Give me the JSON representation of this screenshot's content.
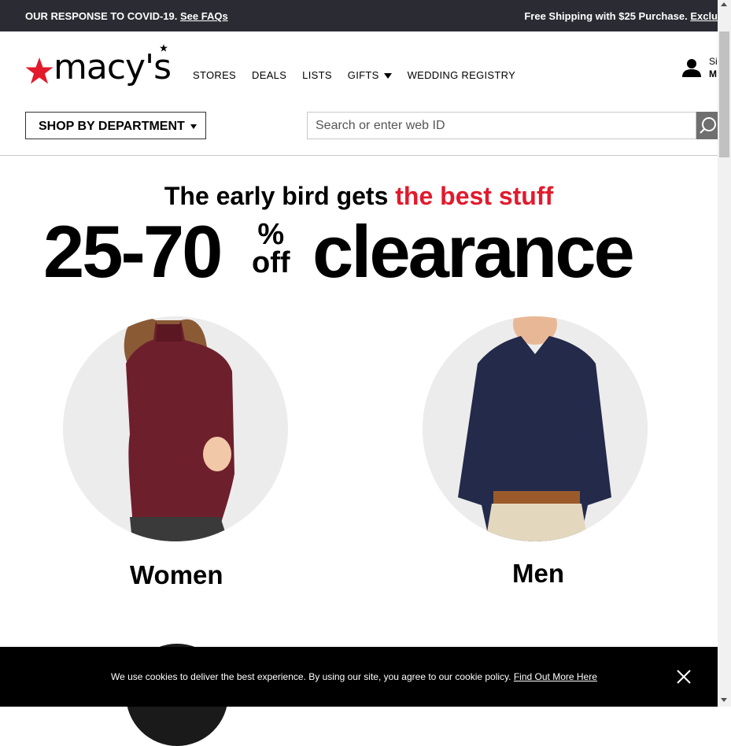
{
  "topbar": {
    "left_text": "OUR RESPONSE TO COVID-19.",
    "left_link": "See FAQs",
    "right_text": "Free Shipping with $25 Purchase.",
    "right_link": "Exclu"
  },
  "header": {
    "logo_text": "macy's",
    "nav": [
      {
        "label": "STORES"
      },
      {
        "label": "DEALS"
      },
      {
        "label": "LISTS"
      },
      {
        "label": "GIFTS"
      },
      {
        "label": "WEDDING REGISTRY"
      }
    ],
    "account_line1": "Si",
    "account_line2": "M",
    "shop_by_department": "SHOP BY DEPARTMENT",
    "search_placeholder": "Search or enter web ID"
  },
  "hero": {
    "line1_black": "The early bird gets ",
    "line1_red": "the best stuff",
    "range": "25-70",
    "percent": "%",
    "off": "off",
    "clearance": "clearance"
  },
  "categories": [
    {
      "label": "Women"
    },
    {
      "label": "Men"
    }
  ],
  "cookie": {
    "message": "We use cookies to deliver the best experience. By using our site, you agree to our cookie policy. ",
    "link": "Find Out More Here"
  },
  "colors": {
    "brand_red": "#e21a2c",
    "topbar_bg": "#2b2c33",
    "cookie_bg": "#000000"
  },
  "icons": {
    "logo_star": "star-icon",
    "account": "user-icon",
    "search": "search-icon",
    "close": "close-icon"
  }
}
